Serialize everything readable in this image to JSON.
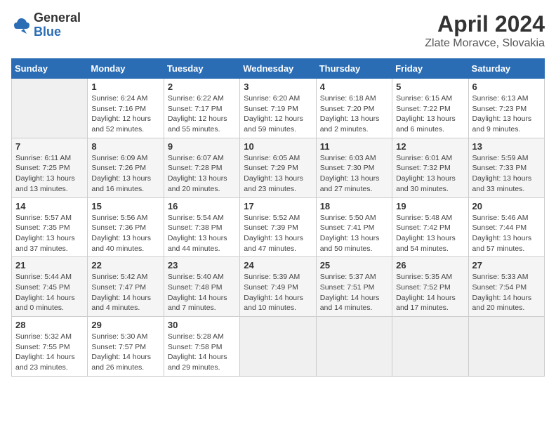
{
  "logo": {
    "general": "General",
    "blue": "Blue"
  },
  "title": "April 2024",
  "location": "Zlate Moravce, Slovakia",
  "weekdays": [
    "Sunday",
    "Monday",
    "Tuesday",
    "Wednesday",
    "Thursday",
    "Friday",
    "Saturday"
  ],
  "weeks": [
    [
      {
        "day": "",
        "empty": true
      },
      {
        "day": "1",
        "sunrise": "6:24 AM",
        "sunset": "7:16 PM",
        "daylight": "12 hours and 52 minutes."
      },
      {
        "day": "2",
        "sunrise": "6:22 AM",
        "sunset": "7:17 PM",
        "daylight": "12 hours and 55 minutes."
      },
      {
        "day": "3",
        "sunrise": "6:20 AM",
        "sunset": "7:19 PM",
        "daylight": "12 hours and 59 minutes."
      },
      {
        "day": "4",
        "sunrise": "6:18 AM",
        "sunset": "7:20 PM",
        "daylight": "13 hours and 2 minutes."
      },
      {
        "day": "5",
        "sunrise": "6:15 AM",
        "sunset": "7:22 PM",
        "daylight": "13 hours and 6 minutes."
      },
      {
        "day": "6",
        "sunrise": "6:13 AM",
        "sunset": "7:23 PM",
        "daylight": "13 hours and 9 minutes."
      }
    ],
    [
      {
        "day": "7",
        "sunrise": "6:11 AM",
        "sunset": "7:25 PM",
        "daylight": "13 hours and 13 minutes."
      },
      {
        "day": "8",
        "sunrise": "6:09 AM",
        "sunset": "7:26 PM",
        "daylight": "13 hours and 16 minutes."
      },
      {
        "day": "9",
        "sunrise": "6:07 AM",
        "sunset": "7:28 PM",
        "daylight": "13 hours and 20 minutes."
      },
      {
        "day": "10",
        "sunrise": "6:05 AM",
        "sunset": "7:29 PM",
        "daylight": "13 hours and 23 minutes."
      },
      {
        "day": "11",
        "sunrise": "6:03 AM",
        "sunset": "7:30 PM",
        "daylight": "13 hours and 27 minutes."
      },
      {
        "day": "12",
        "sunrise": "6:01 AM",
        "sunset": "7:32 PM",
        "daylight": "13 hours and 30 minutes."
      },
      {
        "day": "13",
        "sunrise": "5:59 AM",
        "sunset": "7:33 PM",
        "daylight": "13 hours and 33 minutes."
      }
    ],
    [
      {
        "day": "14",
        "sunrise": "5:57 AM",
        "sunset": "7:35 PM",
        "daylight": "13 hours and 37 minutes."
      },
      {
        "day": "15",
        "sunrise": "5:56 AM",
        "sunset": "7:36 PM",
        "daylight": "13 hours and 40 minutes."
      },
      {
        "day": "16",
        "sunrise": "5:54 AM",
        "sunset": "7:38 PM",
        "daylight": "13 hours and 44 minutes."
      },
      {
        "day": "17",
        "sunrise": "5:52 AM",
        "sunset": "7:39 PM",
        "daylight": "13 hours and 47 minutes."
      },
      {
        "day": "18",
        "sunrise": "5:50 AM",
        "sunset": "7:41 PM",
        "daylight": "13 hours and 50 minutes."
      },
      {
        "day": "19",
        "sunrise": "5:48 AM",
        "sunset": "7:42 PM",
        "daylight": "13 hours and 54 minutes."
      },
      {
        "day": "20",
        "sunrise": "5:46 AM",
        "sunset": "7:44 PM",
        "daylight": "13 hours and 57 minutes."
      }
    ],
    [
      {
        "day": "21",
        "sunrise": "5:44 AM",
        "sunset": "7:45 PM",
        "daylight": "14 hours and 0 minutes."
      },
      {
        "day": "22",
        "sunrise": "5:42 AM",
        "sunset": "7:47 PM",
        "daylight": "14 hours and 4 minutes."
      },
      {
        "day": "23",
        "sunrise": "5:40 AM",
        "sunset": "7:48 PM",
        "daylight": "14 hours and 7 minutes."
      },
      {
        "day": "24",
        "sunrise": "5:39 AM",
        "sunset": "7:49 PM",
        "daylight": "14 hours and 10 minutes."
      },
      {
        "day": "25",
        "sunrise": "5:37 AM",
        "sunset": "7:51 PM",
        "daylight": "14 hours and 14 minutes."
      },
      {
        "day": "26",
        "sunrise": "5:35 AM",
        "sunset": "7:52 PM",
        "daylight": "14 hours and 17 minutes."
      },
      {
        "day": "27",
        "sunrise": "5:33 AM",
        "sunset": "7:54 PM",
        "daylight": "14 hours and 20 minutes."
      }
    ],
    [
      {
        "day": "28",
        "sunrise": "5:32 AM",
        "sunset": "7:55 PM",
        "daylight": "14 hours and 23 minutes."
      },
      {
        "day": "29",
        "sunrise": "5:30 AM",
        "sunset": "7:57 PM",
        "daylight": "14 hours and 26 minutes."
      },
      {
        "day": "30",
        "sunrise": "5:28 AM",
        "sunset": "7:58 PM",
        "daylight": "14 hours and 29 minutes."
      },
      {
        "day": "",
        "empty": true
      },
      {
        "day": "",
        "empty": true
      },
      {
        "day": "",
        "empty": true
      },
      {
        "day": "",
        "empty": true
      }
    ]
  ]
}
